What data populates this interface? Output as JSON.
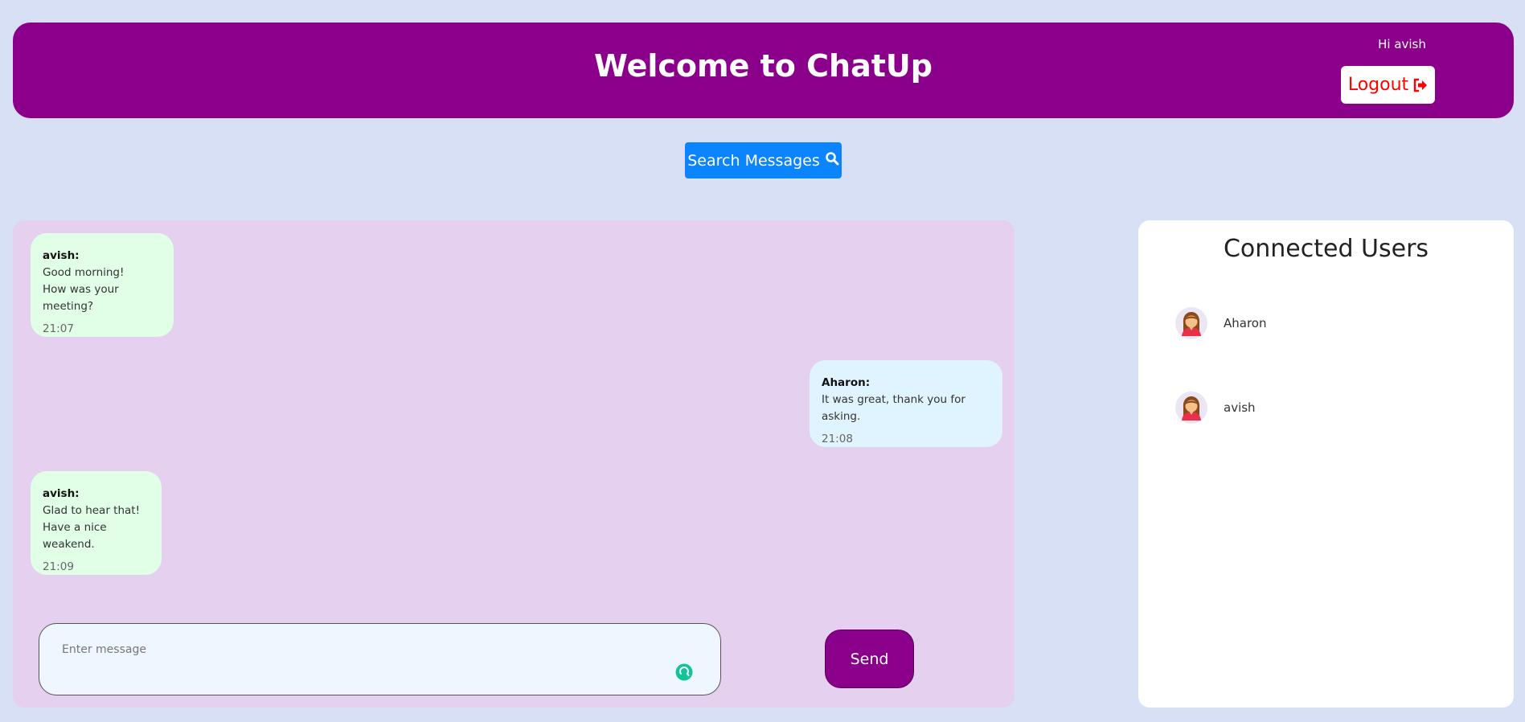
{
  "header": {
    "title": "Welcome to ChatUp",
    "greeting": "Hi avish",
    "logout_label": "Logout",
    "logout_icon": "sign-out-icon",
    "background_color": "#8b008b"
  },
  "search": {
    "label": "Search Messages",
    "icon": "search-icon",
    "color": "#0a84ff"
  },
  "messages": [
    {
      "sender": "avish:",
      "lines": [
        "Good morning!",
        "How was your meeting?"
      ],
      "time": "21:07",
      "side": "left",
      "color": "#e0ffe6"
    },
    {
      "sender": "Aharon:",
      "lines": [
        "It was great, thank you for asking."
      ],
      "time": "21:08",
      "side": "right",
      "color": "#e0f4ff"
    },
    {
      "sender": "avish:",
      "lines": [
        "Glad to hear that!",
        "Have a nice weakend."
      ],
      "time": "21:09",
      "side": "left",
      "color": "#e0ffe6"
    }
  ],
  "composer": {
    "placeholder": "Enter message",
    "send_label": "Send"
  },
  "users_panel": {
    "title": "Connected Users",
    "users": [
      {
        "name": "Aharon",
        "avatar_icon": "woman-avatar-icon"
      },
      {
        "name": "avish",
        "avatar_icon": "woman-avatar-icon"
      }
    ]
  }
}
